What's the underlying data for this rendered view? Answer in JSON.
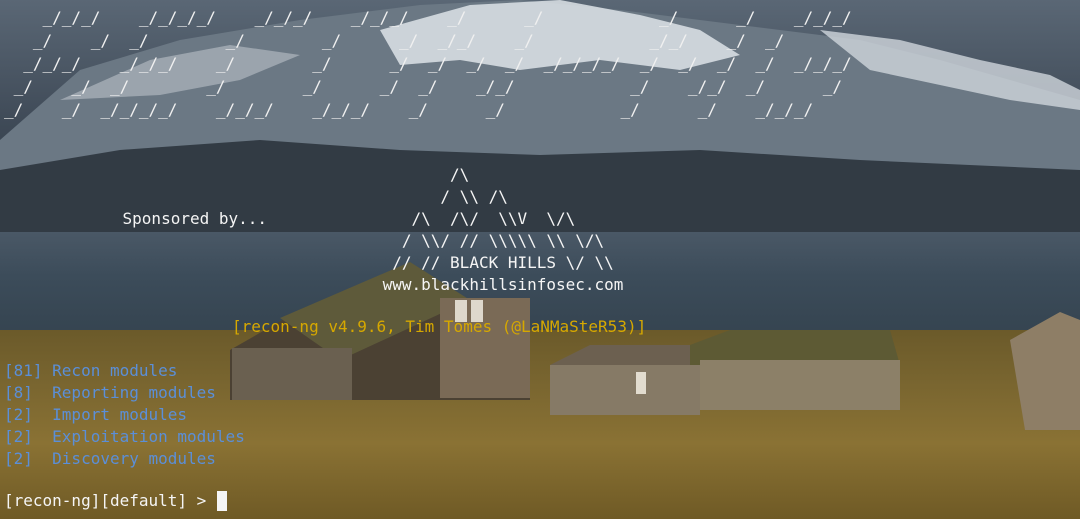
{
  "banner": {
    "art": "    _/_/_/    _/_/_/_/    _/_/_/    _/_/_/    _/      _/            _/      _/    _/_/_/\n   _/    _/  _/        _/        _/      _/  _/_/    _/            _/_/    _/  _/\n  _/_/_/    _/_/_/    _/        _/      _/  _/  _/  _/  _/_/_/_/  _/  _/  _/  _/  _/_/_/\n _/    _/  _/        _/        _/      _/  _/    _/_/            _/    _/_/  _/      _/\n_/    _/  _/_/_/_/    _/_/_/    _/_/_/    _/      _/            _/      _/    _/_/_/"
  },
  "sponsor": {
    "art": "                                      /\\\n                                     / \\\\ /\\\n    Sponsored by...               /\\  /\\/  \\\\V  \\/\\\n                                 / \\\\/ // \\\\\\\\\\ \\\\ \\/\\\n                                // // BLACK HILLS \\/ \\\\\n                               www.blackhillsinfosec.com"
  },
  "version_line": "[recon-ng v4.9.6, Tim Tomes (@LaNMaSteR53)]",
  "modules": [
    "[81] Recon modules",
    "[8]  Reporting modules",
    "[2]  Import modules",
    "[2]  Exploitation modules",
    "[2]  Discovery modules"
  ],
  "prompt": "[recon-ng][default] >",
  "colors": {
    "text": "#f2f2f2",
    "version": "#d6a800",
    "modules": "#5b8fd8"
  }
}
